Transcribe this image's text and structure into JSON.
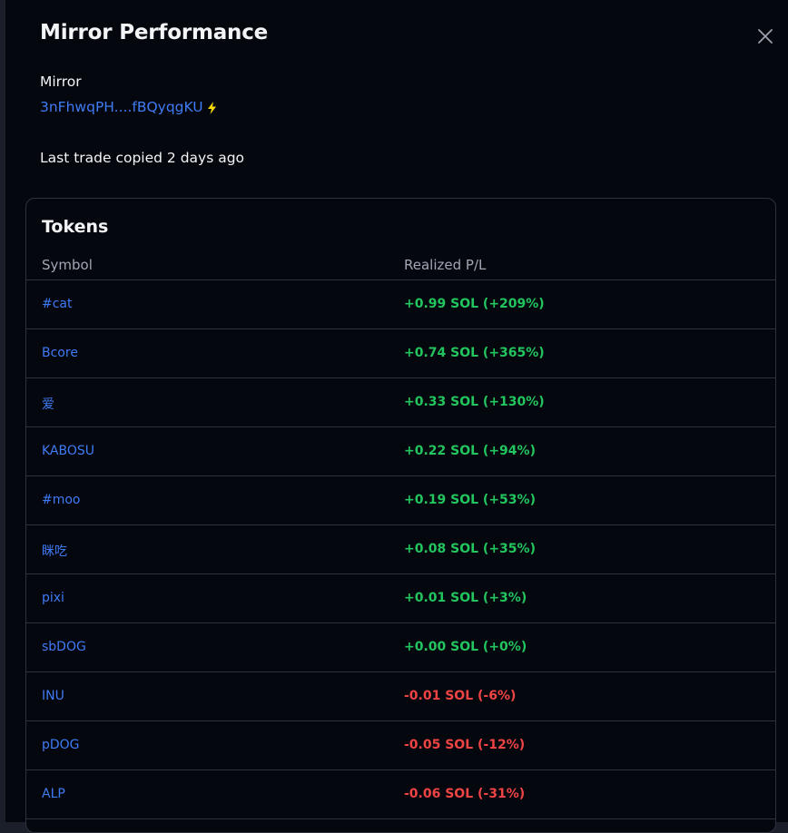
{
  "modal": {
    "title": "Mirror Performance",
    "mirror_label": "Mirror",
    "mirror_address": "3nFhwqPH....fBQyqgKU",
    "last_trade": "Last trade copied 2 days ago",
    "close_icon": "close-icon",
    "bolt_icon": "lightning-bolt-icon"
  },
  "tokens": {
    "title": "Tokens",
    "columns": {
      "symbol": "Symbol",
      "pl": "Realized P/L"
    },
    "rows": [
      {
        "symbol": "#cat",
        "pl": "+0.99 SOL (+209%)",
        "status": "pos"
      },
      {
        "symbol": "Bcore",
        "pl": "+0.74 SOL (+365%)",
        "status": "pos"
      },
      {
        "symbol": "爱",
        "pl": "+0.33 SOL (+130%)",
        "status": "pos"
      },
      {
        "symbol": "KABOSU",
        "pl": "+0.22 SOL (+94%)",
        "status": "pos"
      },
      {
        "symbol": "#moo",
        "pl": "+0.19 SOL (+53%)",
        "status": "pos"
      },
      {
        "symbol": "眯吃",
        "pl": "+0.08 SOL (+35%)",
        "status": "pos"
      },
      {
        "symbol": "pixi",
        "pl": "+0.01 SOL (+3%)",
        "status": "pos"
      },
      {
        "symbol": "sbDOG",
        "pl": "+0.00 SOL (+0%)",
        "status": "pos"
      },
      {
        "symbol": "INU",
        "pl": "-0.01 SOL (-6%)",
        "status": "neg"
      },
      {
        "symbol": "pDOG",
        "pl": "-0.05 SOL (-12%)",
        "status": "neg"
      },
      {
        "symbol": "ALP",
        "pl": "-0.06 SOL (-31%)",
        "status": "neg"
      }
    ]
  },
  "colors": {
    "background": "#05070f",
    "link": "#3f7bf4",
    "positive": "#22c55e",
    "negative": "#ef4444",
    "border": "#2d323d",
    "bolt": "#f5d90a"
  }
}
